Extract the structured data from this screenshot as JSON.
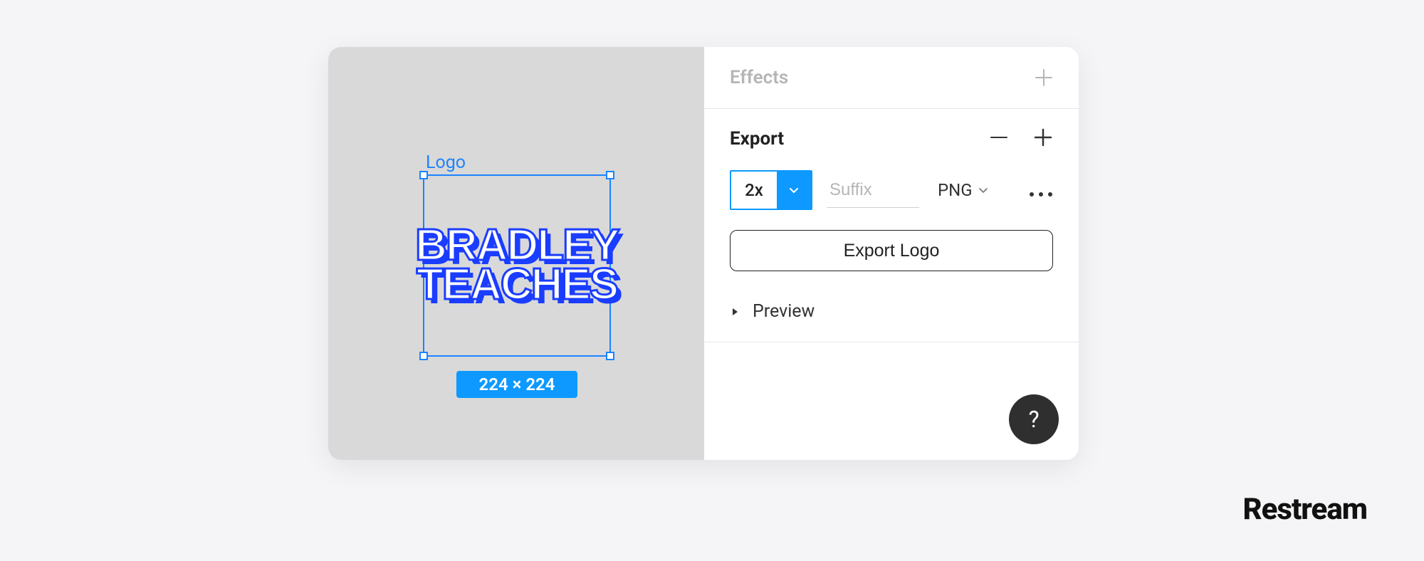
{
  "canvas": {
    "frame_name": "Logo",
    "logo_text_line1": "BRADLEY",
    "logo_text_line2": "TEACHES",
    "dimensions_badge": "224 × 224"
  },
  "inspector": {
    "effects": {
      "title": "Effects"
    },
    "export": {
      "title": "Export",
      "scale_value": "2x",
      "suffix_placeholder": "Suffix",
      "format": "PNG",
      "button_label": "Export Logo",
      "preview_label": "Preview"
    }
  },
  "help": {
    "label": "?"
  },
  "watermark": "Restream"
}
